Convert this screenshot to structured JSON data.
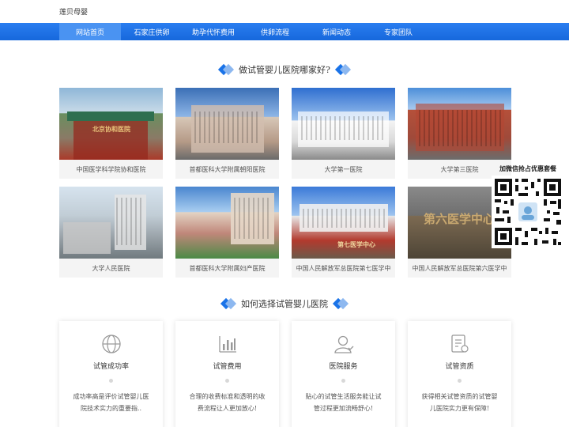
{
  "site": {
    "name": "莲贝母婴"
  },
  "nav": {
    "items": [
      {
        "label": "网站首页",
        "active": true
      },
      {
        "label": "石家庄供卵",
        "active": false
      },
      {
        "label": "助孕代怀费用",
        "active": false
      },
      {
        "label": "供卵流程",
        "active": false
      },
      {
        "label": "新闻动态",
        "active": false
      },
      {
        "label": "专家团队",
        "active": false
      }
    ]
  },
  "hospitals_section": {
    "title": "做试管婴儿医院哪家好?",
    "items": [
      {
        "caption": "中国医学科学院协和医院",
        "photo": "hospital-building-photo",
        "sign": "北京协和医院"
      },
      {
        "caption": "首都医科大学附属朝阳医院",
        "photo": "hospital-building-photo"
      },
      {
        "caption": "大学第一医院",
        "photo": "hospital-building-photo"
      },
      {
        "caption": "大学第三医院",
        "photo": "hospital-building-photo"
      },
      {
        "caption": "大学人民医院",
        "photo": "hospital-building-photo"
      },
      {
        "caption": "首都医科大学附属妇产医院",
        "photo": "hospital-building-photo"
      },
      {
        "caption": "中国人民解放军总医院第七医学中",
        "photo": "hospital-building-photo",
        "sign": "第七医学中心"
      },
      {
        "caption": "中国人民解放军总医院第六医学中",
        "photo": "hospital-building-photo",
        "sign": "第六医学中心"
      }
    ]
  },
  "qr": {
    "title": "加微信抢占优惠套餐"
  },
  "choose_section": {
    "title": "如何选择试管婴儿医院",
    "cards": [
      {
        "icon": "globe-icon",
        "title": "试管成功率",
        "desc": "成功率高是评价试管婴儿医院技术实力的重要指.."
      },
      {
        "icon": "bar-chart-icon",
        "title": "试管费用",
        "desc": "合理的收费标准和透明的收费流程让人更加放心!"
      },
      {
        "icon": "user-icon",
        "title": "医院服务",
        "desc": "贴心的试管生活服务能让试管过程更加流畅舒心!"
      },
      {
        "icon": "document-icon",
        "title": "试管资质",
        "desc": "获得相关试管资质的试管婴儿医院实力更有保障!"
      }
    ]
  },
  "colors": {
    "brand": "#1a73e8",
    "nav_active": "#4a93f2"
  }
}
